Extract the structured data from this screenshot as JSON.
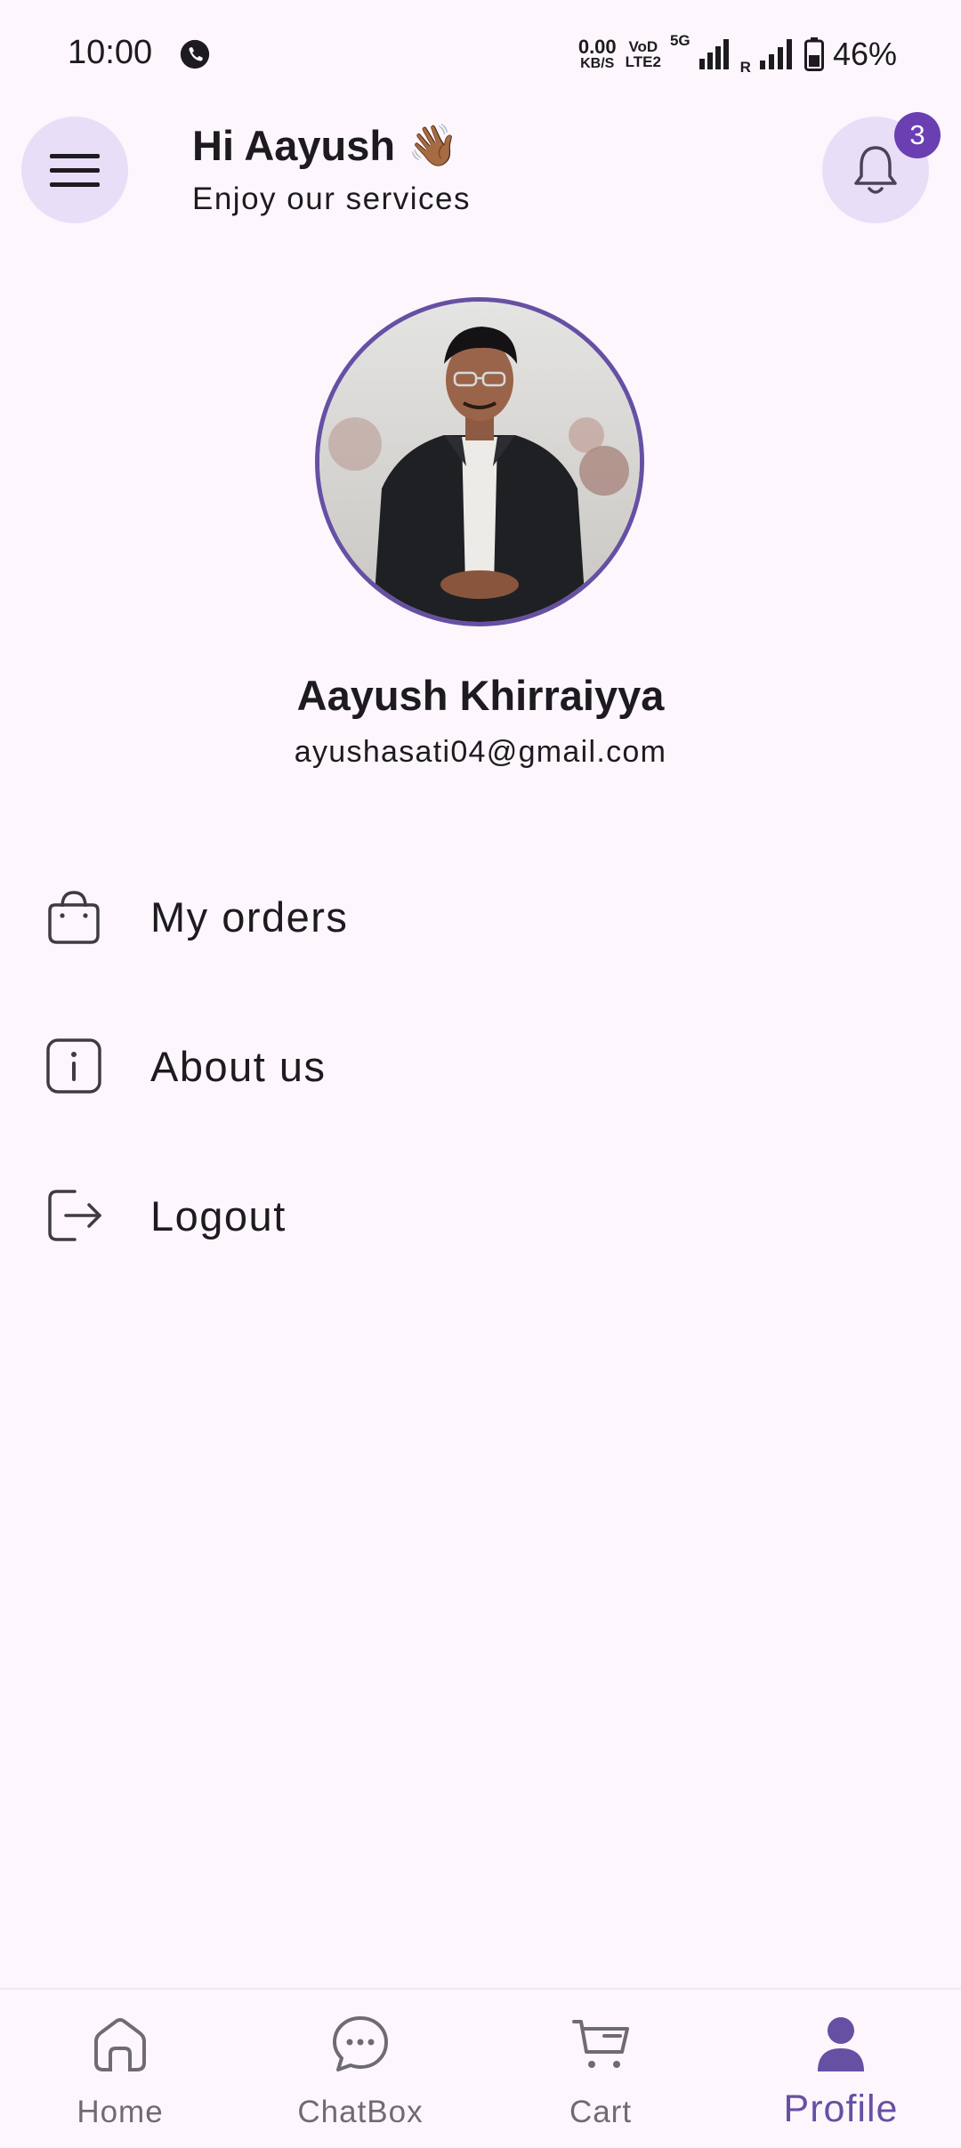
{
  "status_bar": {
    "time": "10:00",
    "speed_value": "0.00",
    "speed_unit": "KB/S",
    "volte_top": "VoD",
    "volte_bottom": "LTE2",
    "network": "5G",
    "roaming": "R",
    "battery": "46%"
  },
  "header": {
    "greeting": "Hi Aayush",
    "wave_emoji": "👋🏾",
    "subtitle": "Enjoy our services",
    "notification_count": "3"
  },
  "profile": {
    "name": "Aayush Khirraiyya",
    "email": "ayushasati04@gmail.com",
    "avatar_border_color": "#6650a4"
  },
  "menu": {
    "items": [
      {
        "label": "My orders",
        "icon": "shopping-bag-icon"
      },
      {
        "label": "About us",
        "icon": "info-icon"
      },
      {
        "label": "Logout",
        "icon": "logout-icon"
      }
    ]
  },
  "bottom_nav": {
    "items": [
      {
        "label": "Home",
        "icon": "home-icon",
        "active": false
      },
      {
        "label": "ChatBox",
        "icon": "chat-icon",
        "active": false
      },
      {
        "label": "Cart",
        "icon": "cart-icon",
        "active": false
      },
      {
        "label": "Profile",
        "icon": "profile-icon",
        "active": true
      }
    ]
  },
  "colors": {
    "accent": "#6650a4",
    "badge": "#6a3fb2",
    "button_bg": "#e9def7",
    "background": "#fdf7fd"
  }
}
